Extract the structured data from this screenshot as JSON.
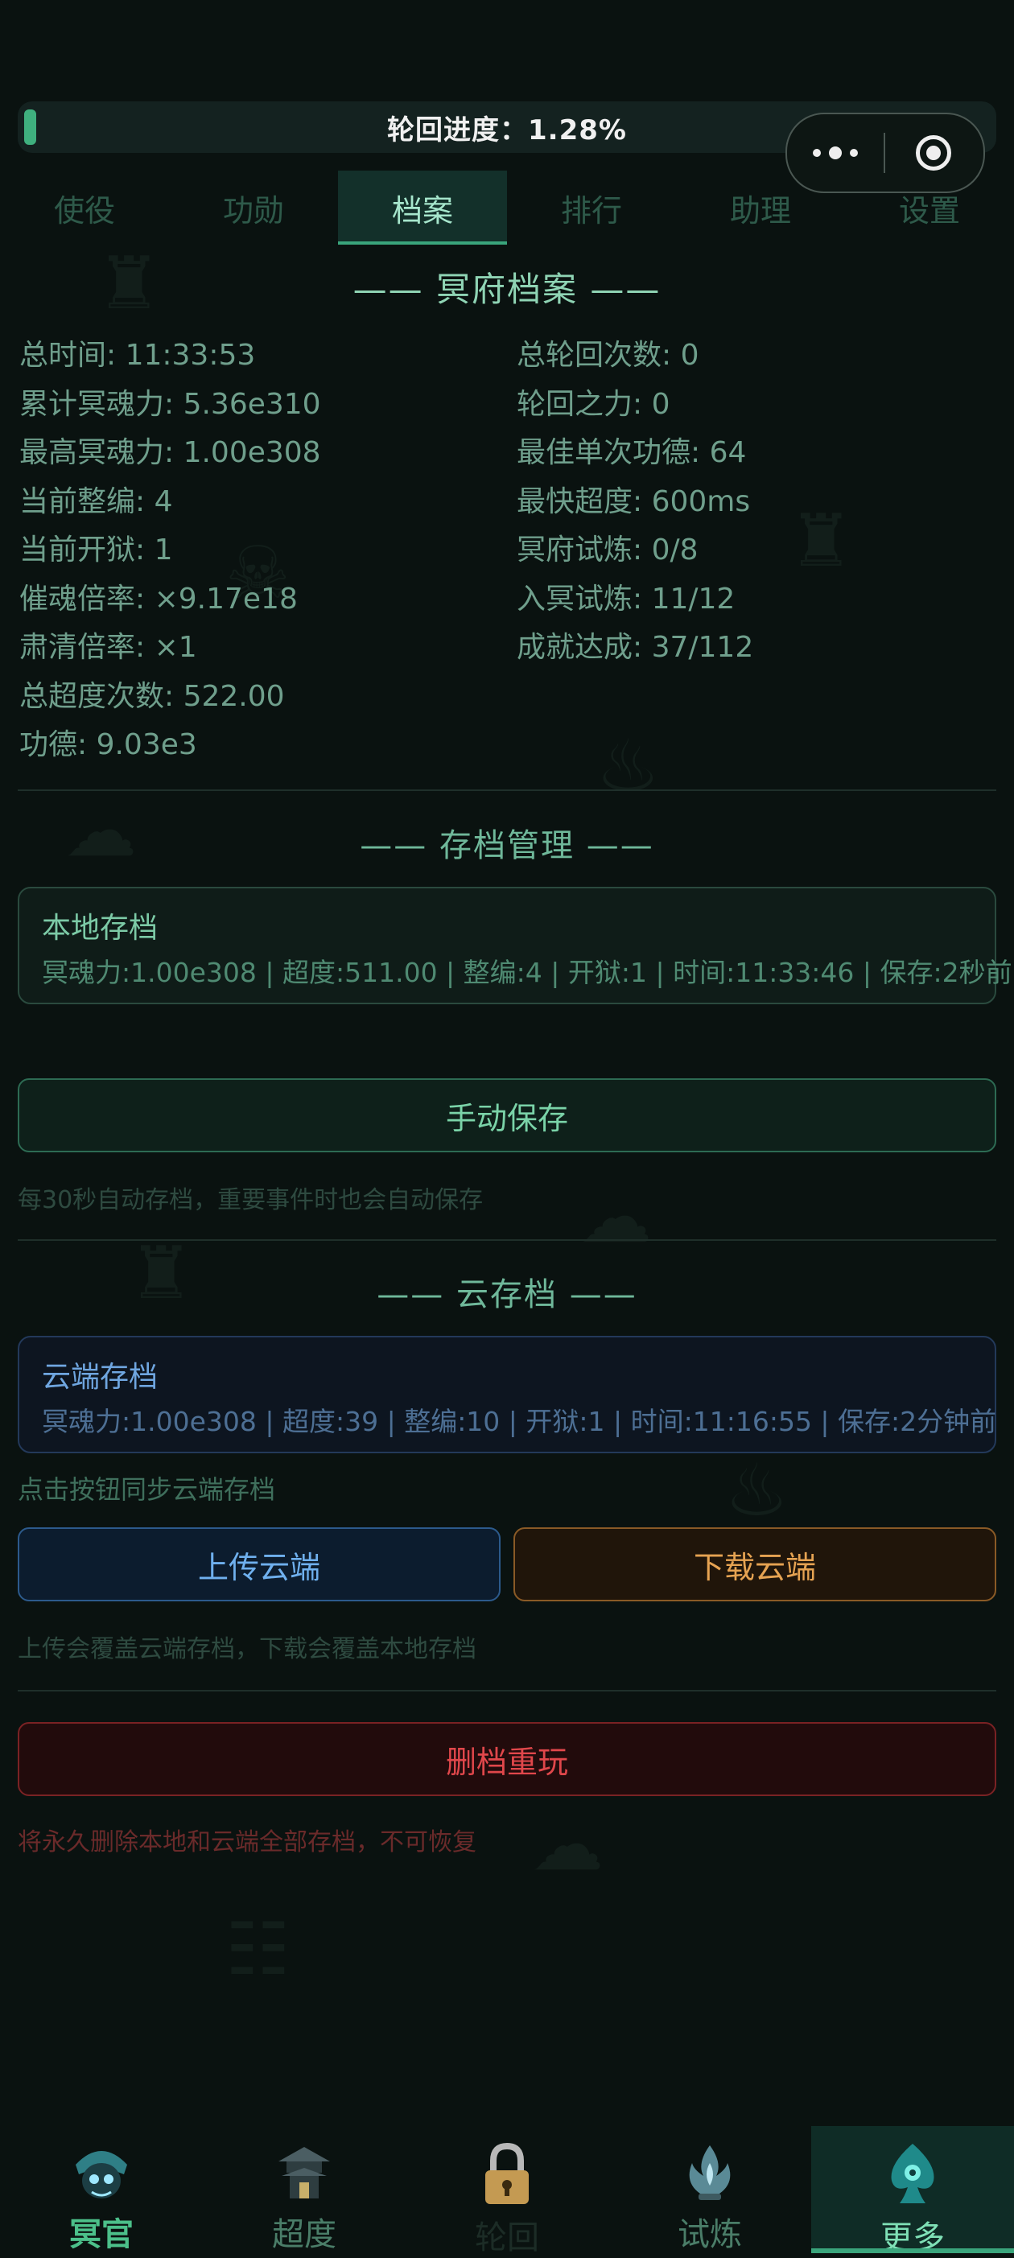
{
  "progress": {
    "label": "轮回进度：1.28%",
    "value_percent": 1.28
  },
  "tabs": [
    {
      "label": "使役"
    },
    {
      "label": "功勋"
    },
    {
      "label": "档案",
      "active": true
    },
    {
      "label": "排行"
    },
    {
      "label": "助理"
    },
    {
      "label": "设置"
    }
  ],
  "archive": {
    "title": "—— 冥府档案 ——",
    "left": [
      "总时间: 11:33:53",
      "累计冥魂力: 5.36e310",
      "最高冥魂力: 1.00e308",
      "当前整编: 4",
      "当前开狱: 1",
      "催魂倍率: ×9.17e18",
      "肃清倍率: ×1",
      "总超度次数: 522.00",
      "功德: 9.03e3"
    ],
    "right": [
      "总轮回次数: 0",
      "轮回之力: 0",
      "最佳单次功德: 64",
      "最快超度: 600ms",
      "冥府试炼: 0/8",
      "入冥试炼: 11/12",
      "成就达成: 37/112"
    ]
  },
  "save_manage": {
    "title": "—— 存档管理 ——",
    "local": {
      "title": "本地存档",
      "info": "冥魂力:1.00e308 | 超度:511.00 | 整编:4 | 开狱:1 | 时间:11:33:46 | 保存:2秒前"
    },
    "manual_save_label": "手动保存",
    "auto_hint": "每30秒自动存档，重要事件时也会自动保存"
  },
  "cloud": {
    "title": "—— 云存档 ——",
    "card_title": "云端存档",
    "info": "冥魂力:1.00e308 | 超度:39 | 整编:10 | 开狱:1 | 时间:11:16:55 | 保存:2分钟前",
    "sync_hint": "点击按钮同步云端存档",
    "upload_label": "上传云端",
    "download_label": "下载云端",
    "overwrite_hint": "上传会覆盖云端存档，下载会覆盖本地存档"
  },
  "danger": {
    "reset_label": "删档重玩",
    "reset_hint": "将永久删除本地和云端全部存档，不可恢复"
  },
  "bottom_nav": [
    {
      "label": "冥官",
      "icon": "ghost-official-icon"
    },
    {
      "label": "超度",
      "icon": "pagoda-icon"
    },
    {
      "label": "轮回",
      "icon": "padlock-icon",
      "locked": true
    },
    {
      "label": "试炼",
      "icon": "flame-lotus-icon"
    },
    {
      "label": "更多",
      "icon": "spade-emblem-icon",
      "active": true
    }
  ],
  "colors": {
    "background": "#0a1210",
    "accent_green": "#3aa57c",
    "cloud_blue": "#6fb0ee",
    "download_orange": "#e6a352",
    "danger_red": "#e0474b"
  }
}
